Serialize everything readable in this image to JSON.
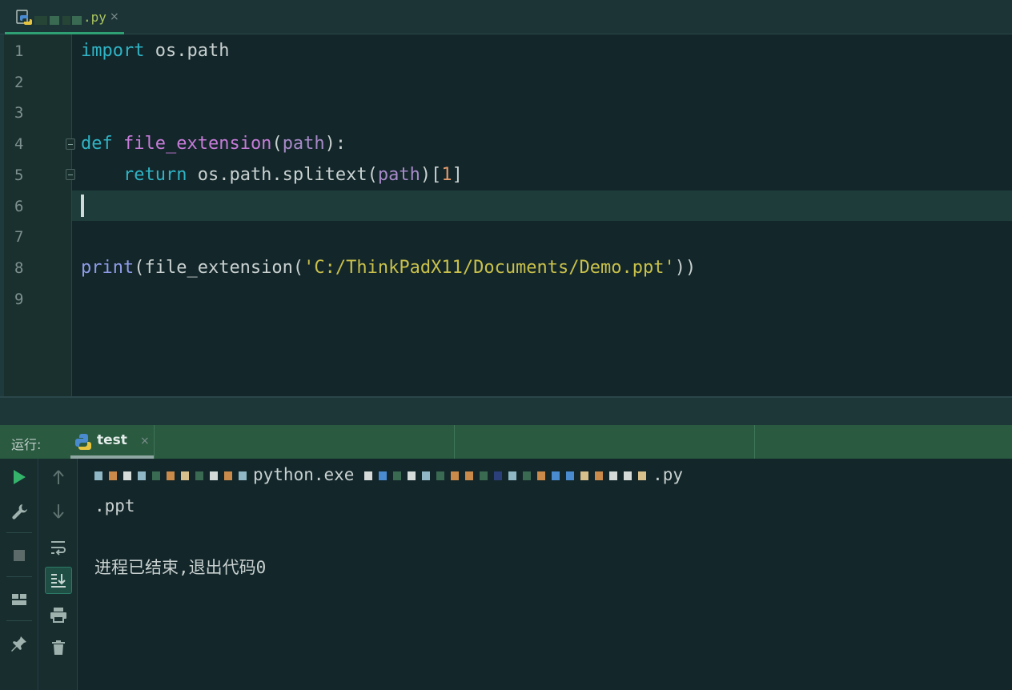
{
  "editor_tab": {
    "file_ext": ".py",
    "close": "×"
  },
  "gutter": {
    "line_numbers": [
      "1",
      "2",
      "3",
      "4",
      "5",
      "6",
      "7",
      "8",
      "9"
    ]
  },
  "code": {
    "line1": {
      "kw": "import",
      "rest": " os.path"
    },
    "line4": {
      "kw": "def",
      "name": "file_extension",
      "open": "(",
      "param": "path",
      "close": "):"
    },
    "line5": {
      "kw": "return",
      "call": " os.path.splitext(",
      "param": "path",
      "mid": ")[",
      "num": "1",
      "end": "]"
    },
    "line8": {
      "fn": "print",
      "open": "(file_extension(",
      "str": "'C:/ThinkPadX11/Documents/Demo.ppt'",
      "close": "))"
    }
  },
  "run_panel": {
    "label": "运行:",
    "tab_label": "test",
    "close": "×"
  },
  "console": {
    "cmd_mid": "python.exe",
    "cmd_end": ".py",
    "output": ".ppt",
    "exit_message": "进程已结束,退出代码0"
  },
  "icons": {
    "run": "play-icon",
    "settings": "wrench-icon",
    "stop": "stop-icon",
    "layout": "layout-icon",
    "pin": "pin-icon",
    "up": "arrow-up-icon",
    "down": "arrow-down-icon",
    "wrap": "soft-wrap-icon",
    "scroll": "scroll-to-end-icon",
    "print": "print-icon",
    "clear": "trash-icon"
  },
  "colors": {
    "keyword": "#2fb3c4",
    "function": "#c67bd8",
    "string": "#c9c14a",
    "accent": "#2ea073"
  }
}
